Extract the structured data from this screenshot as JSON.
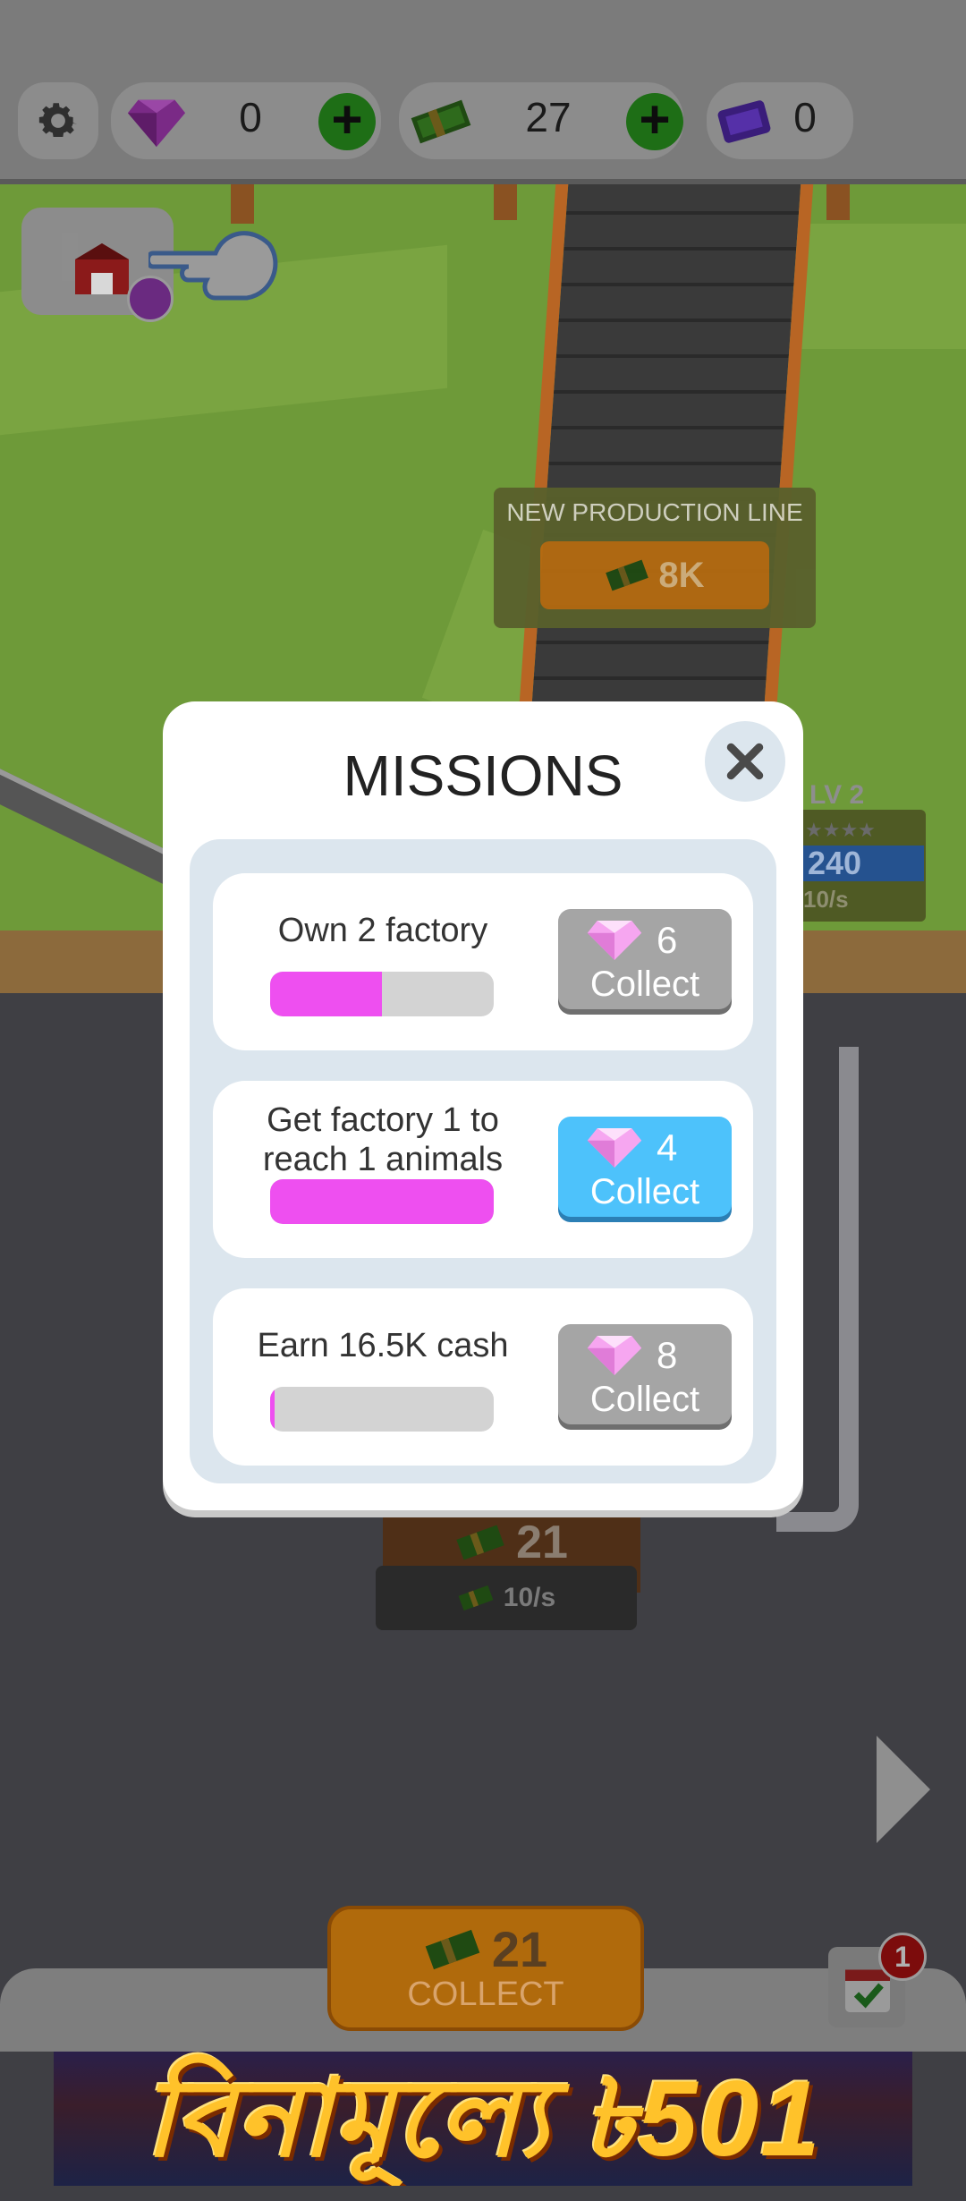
{
  "hud": {
    "gems": "0",
    "cash": "27",
    "tickets": "0"
  },
  "world": {
    "new_line_title": "NEW PRODUCTION LINE",
    "new_line_cost": "8K",
    "factory_level": "LV 2",
    "factory_value": "240",
    "factory_rate": "10/s",
    "lower_cash": "21",
    "lower_rate": "10/s"
  },
  "missions": {
    "title": "MISSIONS",
    "items": [
      {
        "label": "Own 2 factory",
        "progress": 0.5,
        "reward": "6",
        "button": "Collect",
        "state": "locked"
      },
      {
        "label": "Get factory 1 to reach 1 animals",
        "progress": 1.0,
        "reward": "4",
        "button": "Collect",
        "state": "ready"
      },
      {
        "label": "Earn 16.5K cash",
        "progress": 0.02,
        "reward": "8",
        "button": "Collect",
        "state": "locked"
      }
    ]
  },
  "bottom": {
    "collect_amount": "21",
    "collect_label": "COLLECT",
    "calendar_badge": "1"
  },
  "ad": {
    "text": "বিনামূল্যে ৳501"
  },
  "colors": {
    "progress_fill": "#ee4ff0",
    "ready_button": "#4dc2fb",
    "locked_button": "#a5a5a5"
  },
  "icons": [
    "gear-icon",
    "gem-icon",
    "plus-icon",
    "cash-icon",
    "ticket-icon",
    "barn-icon",
    "hammer-icon",
    "pointer-hand-icon",
    "close-icon",
    "right-arrow-icon",
    "calendar-check-icon"
  ]
}
